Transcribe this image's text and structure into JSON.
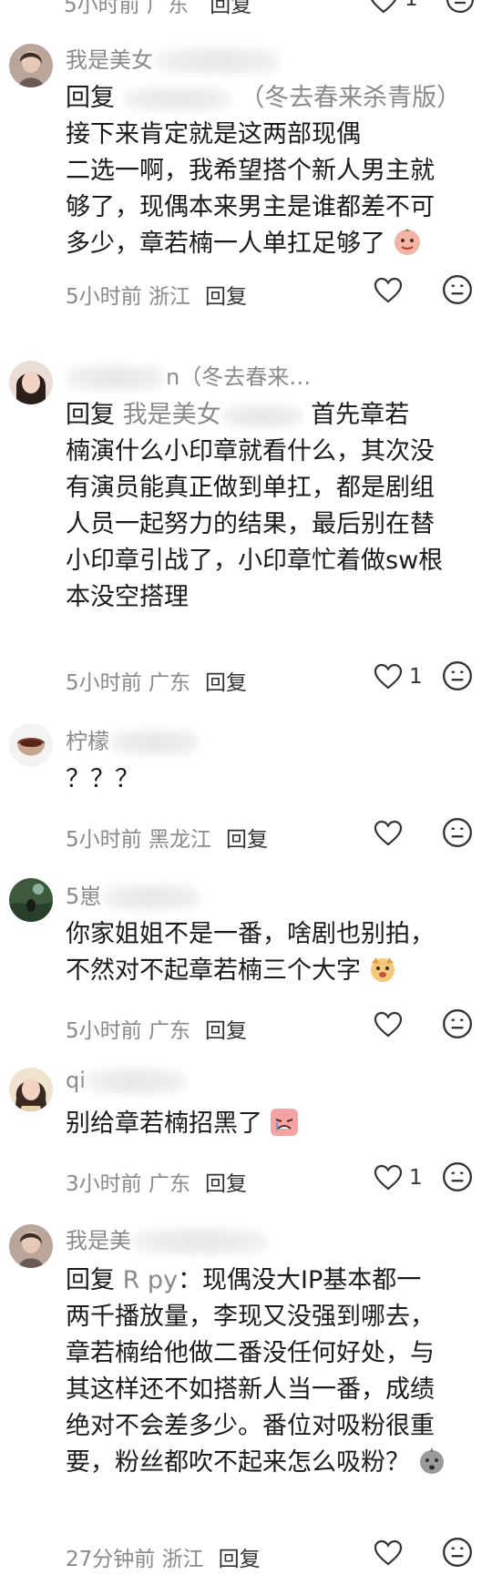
{
  "top_partial": {
    "meta_time": "5小时前 广东",
    "reply_label": "回复",
    "like_count": "1"
  },
  "comments": [
    {
      "username": "我是美女",
      "reply_prefix": "回复",
      "reply_target": "（冬去春来杀青版）",
      "text_lines": [
        "接下来肯定就是这两部现偶",
        "二选一啊，我希望搭个新人男主就",
        "够了，现偶本来男主是谁都差不可",
        "多少，章若楠一人单扛足够了"
      ],
      "line1_after_target": "：接下来肯定就是这两部现偶",
      "time_location": "5小时前 浙江",
      "reply_label": "回复",
      "like_count": ""
    },
    {
      "username": "n（冬去春来…",
      "reply_prefix": "回复",
      "reply_target": "我是美女",
      "text_lines": [
        "首先章若",
        "楠演什么小印章就看什么，其次没",
        "有演员能真正做到单扛，都是剧组",
        "人员一起努力的结果，最后别在替",
        "小印章引战了，小印章忙着做sw根",
        "本没空搭理"
      ],
      "time_location": "5小时前 广东",
      "reply_label": "回复",
      "like_count": "1"
    },
    {
      "username": "柠檬",
      "text_lines": [
        "？？？"
      ],
      "time_location": "5小时前 黑龙江",
      "reply_label": "回复",
      "like_count": ""
    },
    {
      "username": "5崽",
      "text_lines": [
        "你家姐姐不是一番，啥剧也别拍，",
        "不然对不起章若楠三个大字"
      ],
      "time_location": "5小时前 广东",
      "reply_label": "回复",
      "like_count": ""
    },
    {
      "username": "qi",
      "text_lines": [
        "别给章若楠招黑了"
      ],
      "time_location": "3小时前 广东",
      "reply_label": "回复",
      "like_count": "1"
    },
    {
      "username": "我是美",
      "reply_prefix": "回复",
      "reply_target": "R py",
      "text_lines": [
        "：现偶没大IP基本都一",
        "两千播放量，李现又没强到哪去，",
        "章若楠给他做二番没任何好处，与",
        "其这样还不如搭新人当一番，成绩",
        "绝对不会差多少。番位对吸粉很重",
        "要，粉丝都吹不起来怎么吸粉？"
      ],
      "time_location": "27分钟前 浙江",
      "reply_label": "回复",
      "like_count": ""
    }
  ],
  "icons": {
    "heart": "heart-outline-icon",
    "more": "meh-face-icon",
    "accent_text": "#1b1b1b",
    "muted_text": "#8a8a8a"
  }
}
